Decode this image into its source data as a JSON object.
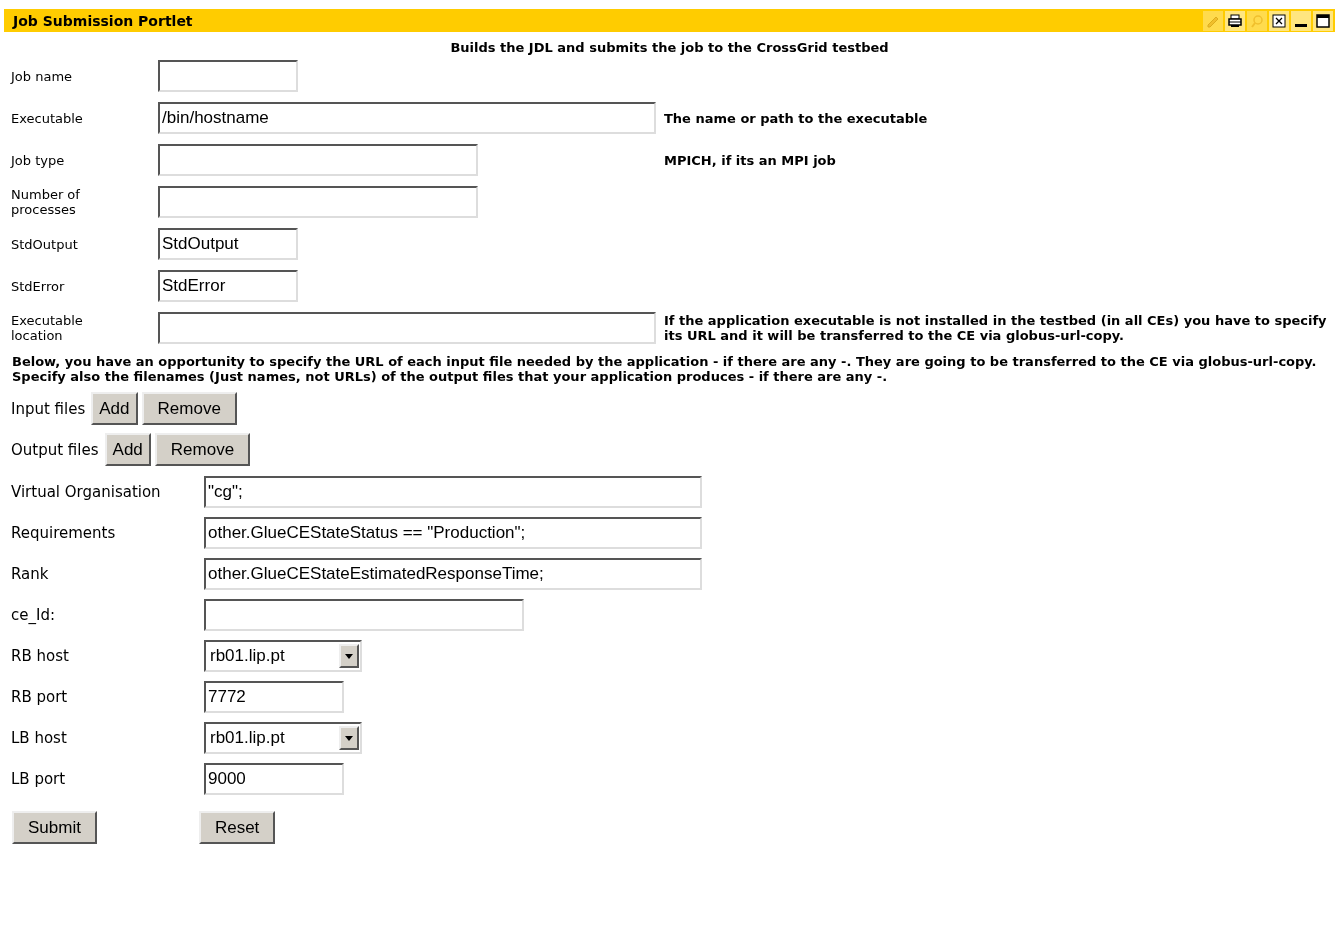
{
  "window": {
    "title": "Job Submission Portlet"
  },
  "window_controls": [
    {
      "kind": "edit",
      "disabled": true
    },
    {
      "kind": "print",
      "disabled": false
    },
    {
      "kind": "search",
      "disabled": true
    },
    {
      "kind": "close",
      "disabled": false
    },
    {
      "kind": "minimize",
      "disabled": false
    },
    {
      "kind": "maximize",
      "disabled": false
    }
  ],
  "subtitle": "Builds the JDL and submits the job to the CrossGrid testbed",
  "upper_fields": [
    {
      "label": "Job name",
      "kind": "short"
    },
    {
      "label": "Executable",
      "kind": "long",
      "value": "/bin/hostname",
      "note": "The name or path to the executable"
    },
    {
      "label": "Job type",
      "kind": "medium",
      "note": "MPICH, if its an MPI job"
    },
    {
      "label": "Number of processes",
      "kind": "medium"
    },
    {
      "label": "StdOutput",
      "kind": "short",
      "value": "StdOutput"
    },
    {
      "label": "StdError",
      "kind": "short",
      "value": "StdError"
    },
    {
      "label": "Executable location",
      "kind": "long",
      "note": "If the application executable is not installed in the testbed (in all CEs) you have to specify its URL and it will be transferred to the CE via globus-url-copy."
    }
  ],
  "instructions": [
    "Below, you have an opportunity to specify the URL of each input file needed by the application - if there are any -. They are going to be transferred to the CE via globus-url-copy.",
    "Specify also the filenames (Just names, not URLs) of the output files that your application produces - if there are any -."
  ],
  "file_rows": [
    {
      "label": "Input files",
      "buttons": [
        "Add",
        "Remove"
      ]
    },
    {
      "label": "Output files",
      "buttons": [
        "Add",
        "Remove"
      ]
    }
  ],
  "lower_fields": [
    {
      "label": "Virtual Organisation",
      "kind": "long",
      "value": "\"cg\";"
    },
    {
      "label": "Requirements",
      "kind": "long",
      "value": "other.GlueCEStateStatus == \"Production\";"
    },
    {
      "label": "Rank",
      "kind": "long",
      "value": "other.GlueCEStateEstimatedResponseTime;"
    },
    {
      "label": "ce_Id:",
      "kind": "medium"
    },
    {
      "label": "RB host",
      "kind": "select",
      "value": "rb01.lip.pt"
    },
    {
      "label": "RB port",
      "kind": "short",
      "value": "7772"
    },
    {
      "label": "LB host",
      "kind": "select",
      "value": "rb01.lip.pt"
    },
    {
      "label": "LB port",
      "kind": "short",
      "value": "9000"
    }
  ],
  "buttons": [
    "Submit",
    "Reset"
  ]
}
